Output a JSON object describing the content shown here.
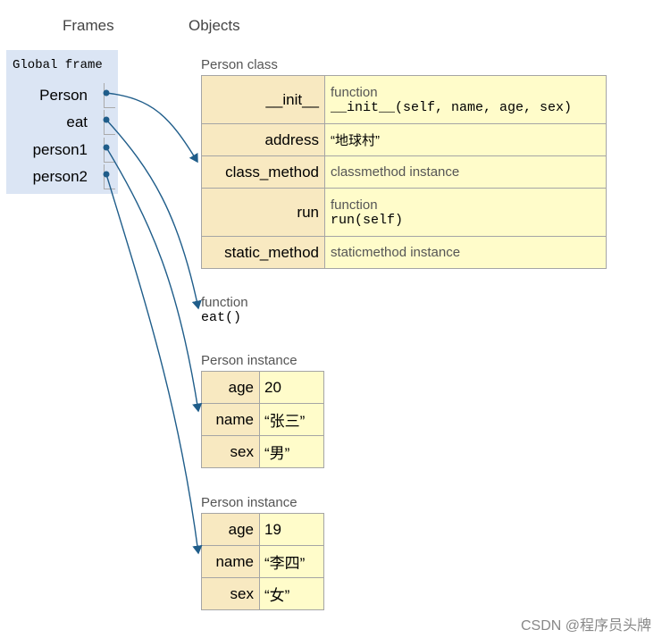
{
  "headers": {
    "frames": "Frames",
    "objects": "Objects"
  },
  "global_frame": {
    "title": "Global frame",
    "vars": [
      "Person",
      "eat",
      "person1",
      "person2"
    ]
  },
  "person_class": {
    "label": "Person class",
    "rows": [
      {
        "key": "__init__",
        "type": "function",
        "value": "__init__(self,  name,  age,  sex)"
      },
      {
        "key": "address",
        "value": "“地球村”"
      },
      {
        "key": "class_method",
        "value": "classmethod instance"
      },
      {
        "key": "run",
        "type": "function",
        "value": "run(self)"
      },
      {
        "key": "static_method",
        "value": "staticmethod instance"
      }
    ]
  },
  "eat_function": {
    "label": "function",
    "sig": "eat()"
  },
  "instances": [
    {
      "label": "Person instance",
      "rows": [
        {
          "key": "age",
          "value": "20"
        },
        {
          "key": "name",
          "value": "“张三”"
        },
        {
          "key": "sex",
          "value": "“男”"
        }
      ]
    },
    {
      "label": "Person instance",
      "rows": [
        {
          "key": "age",
          "value": "19"
        },
        {
          "key": "name",
          "value": "“李四”"
        },
        {
          "key": "sex",
          "value": "“女”"
        }
      ]
    }
  ],
  "watermark": "CSDN @程序员头牌",
  "colors": {
    "frame_bg": "#dbe5f4",
    "key_bg": "#f8e9c1",
    "value_bg": "#fffcca",
    "arrow": "#1f5d8a"
  }
}
